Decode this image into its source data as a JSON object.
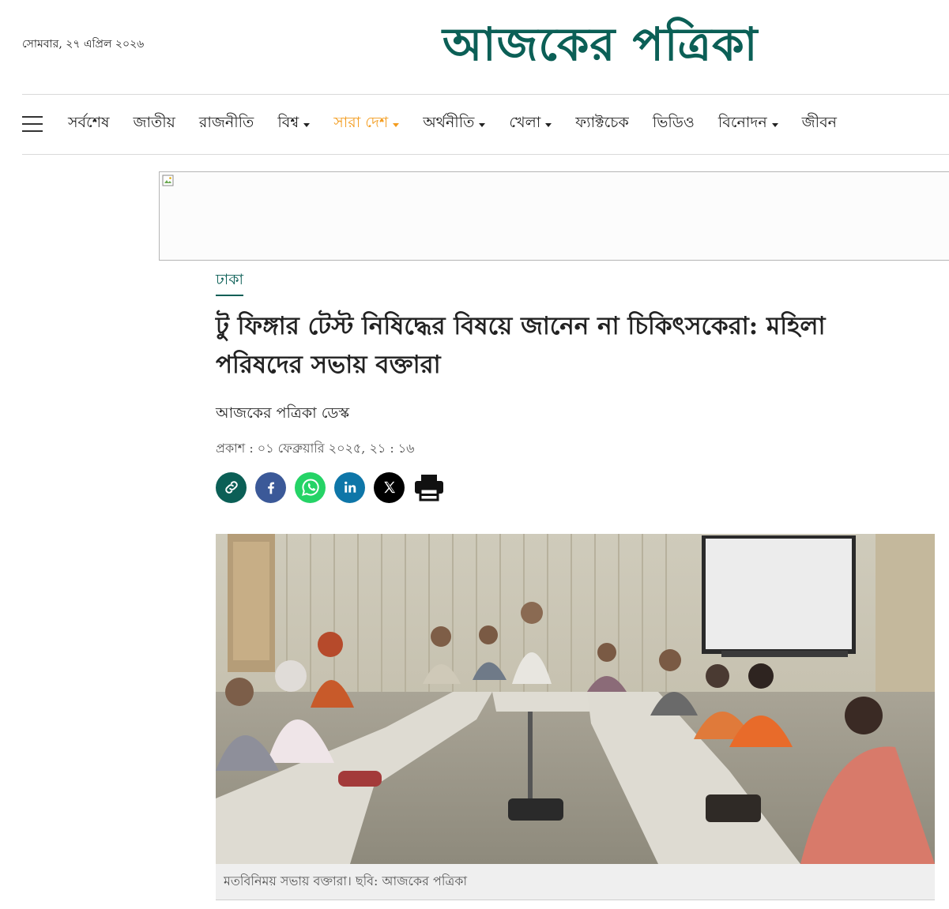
{
  "header": {
    "date": "সোমবার, ২৭ এপ্রিল ২০২৬",
    "logo_text": "আজকের পত্রিকা",
    "brand_color": "#0b5f56"
  },
  "nav": {
    "items": [
      {
        "label": "সর্বশেষ",
        "has_dropdown": false
      },
      {
        "label": "জাতীয়",
        "has_dropdown": false
      },
      {
        "label": "রাজনীতি",
        "has_dropdown": false
      },
      {
        "label": "বিশ্ব",
        "has_dropdown": true
      },
      {
        "label": "সারা দেশ",
        "has_dropdown": true,
        "active": true
      },
      {
        "label": "অর্থনীতি",
        "has_dropdown": true
      },
      {
        "label": "খেলা",
        "has_dropdown": true
      },
      {
        "label": "ফ্যাক্টচেক",
        "has_dropdown": false
      },
      {
        "label": "ভিডিও",
        "has_dropdown": false
      },
      {
        "label": "বিনোদন",
        "has_dropdown": true
      },
      {
        "label": "জীবন",
        "has_dropdown": false
      }
    ],
    "active_color": "#f39c1f"
  },
  "article": {
    "category": "ঢাকা",
    "headline": "টু ফিঙ্গার টেস্ট নিষিদ্ধের বিষয়ে জানেন না চিকিৎসকেরা: মহিলা পরিষদের সভায় বক্তারা",
    "byline": "আজকের পত্রিকা ডেস্ক",
    "published": "প্রকাশ : ০১ ফেব্রুয়ারি ২০২৫, ২১ : ১৬",
    "caption": "মতবিনিময় সভায় বক্তারা। ছবি: আজকের পত্রিকা"
  },
  "share": [
    {
      "icon": "link-icon",
      "color": "#0b5f56"
    },
    {
      "icon": "facebook-icon",
      "color": "#3b5998"
    },
    {
      "icon": "whatsapp-icon",
      "color": "#25d366"
    },
    {
      "icon": "linkedin-icon",
      "color": "#0e76a8"
    },
    {
      "icon": "x-twitter-icon",
      "color": "#000000"
    },
    {
      "icon": "print-icon",
      "color": "#111111"
    }
  ]
}
